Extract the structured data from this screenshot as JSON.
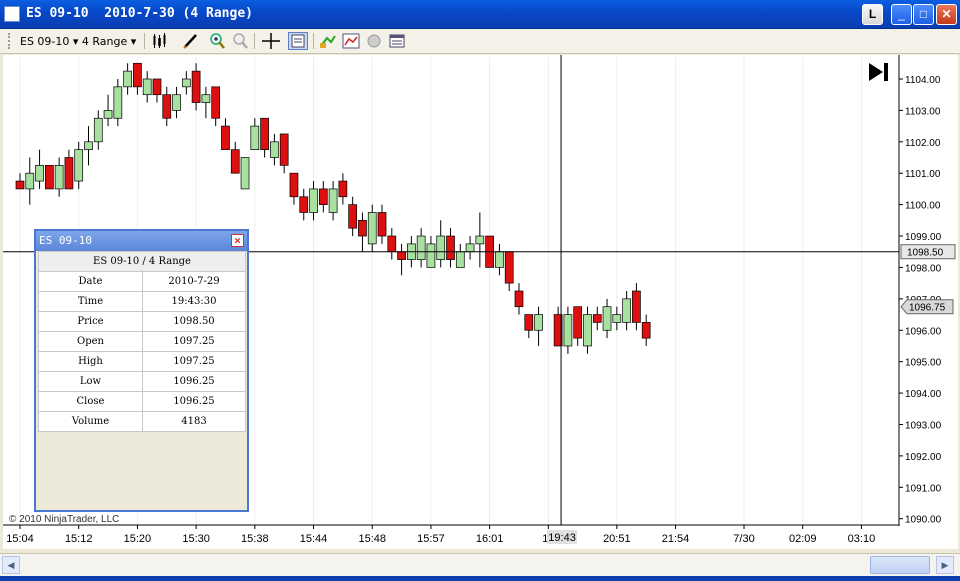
{
  "window": {
    "title": "ES 09-10  2010-7-30 (4 Range)",
    "buttons": {
      "l": "L",
      "minimize": "_",
      "maximize": "□",
      "close": "✕"
    }
  },
  "toolbar": {
    "instrument": "ES 09-10 ▾ 4 Range ▾",
    "icons": [
      "candlestick-icon",
      "pencil-icon",
      "zoom-in-icon",
      "zoom-out-icon",
      "crosshair-icon",
      "data-box-icon",
      "instrument-icon",
      "indicators-icon",
      "strategy-icon",
      "properties-icon"
    ]
  },
  "copyright": "© 2010 NinjaTrader, LLC",
  "colors": {
    "up": "#a8e0a0",
    "down": "#dd1010",
    "wick": "#000000",
    "crosshair": "#000000"
  },
  "chart_data": {
    "type": "candlestick",
    "ylim": [
      1089.8,
      1104.7
    ],
    "y_ticks": [
      "1104.00",
      "1103.00",
      "1102.00",
      "1101.00",
      "1100.00",
      "1099.00",
      "1098.00",
      "1097.00",
      "1096.00",
      "1095.00",
      "1094.00",
      "1093.00",
      "1092.00",
      "1091.00",
      "1090.00"
    ],
    "y_tick_values": [
      1104,
      1103,
      1102,
      1101,
      1100,
      1099,
      1098,
      1097,
      1096,
      1095,
      1094,
      1093,
      1092,
      1091,
      1090
    ],
    "x_ticks": [
      "15:04",
      "15:12",
      "15:20",
      "15:30",
      "15:38",
      "15:44",
      "15:48",
      "15:57",
      "16:01",
      "18",
      "20:51",
      "21:54",
      "7/30",
      "02:09",
      "03:10"
    ],
    "x_tick_bars": [
      0,
      6,
      12,
      18,
      24,
      30,
      36,
      42,
      48,
      54,
      61,
      67,
      74,
      80,
      86
    ],
    "crosshair": {
      "price": 1098.5,
      "price_label": "1098.50",
      "bar": 55.3,
      "time_label": "19:43"
    },
    "last_price": {
      "value": 1096.75,
      "label": "1096.75"
    },
    "candles": [
      [
        1100.75,
        1100.5,
        1101.0,
        1100.5
      ],
      [
        1100.5,
        1101.0,
        1101.5,
        1100.0
      ],
      [
        1100.75,
        1101.25,
        1101.75,
        1100.5
      ],
      [
        1101.25,
        1100.5,
        1101.25,
        1100.5
      ],
      [
        1100.5,
        1101.25,
        1101.5,
        1100.25
      ],
      [
        1101.5,
        1100.5,
        1101.75,
        1100.5
      ],
      [
        1100.75,
        1101.75,
        1102.0,
        1100.5
      ],
      [
        1101.75,
        1102.0,
        1102.5,
        1101.25
      ],
      [
        1102.0,
        1102.75,
        1103.0,
        1101.75
      ],
      [
        1102.75,
        1103.0,
        1103.5,
        1102.5
      ],
      [
        1102.75,
        1103.75,
        1104.0,
        1102.5
      ],
      [
        1103.75,
        1104.25,
        1104.5,
        1103.5
      ],
      [
        1104.5,
        1103.75,
        1104.5,
        1103.5
      ],
      [
        1103.5,
        1104.0,
        1104.25,
        1103.25
      ],
      [
        1104.0,
        1103.5,
        1104.0,
        1103.25
      ],
      [
        1103.5,
        1102.75,
        1103.75,
        1102.5
      ],
      [
        1103.0,
        1103.5,
        1103.75,
        1102.75
      ],
      [
        1103.75,
        1104.0,
        1104.25,
        1103.5
      ],
      [
        1104.25,
        1103.25,
        1104.5,
        1103.0
      ],
      [
        1103.25,
        1103.5,
        1103.75,
        1102.75
      ],
      [
        1103.75,
        1102.75,
        1103.75,
        1102.5
      ],
      [
        1102.5,
        1101.75,
        1102.75,
        1101.75
      ],
      [
        1101.75,
        1101.0,
        1102.0,
        1101.0
      ],
      [
        1100.5,
        1101.5,
        1101.5,
        1100.5
      ],
      [
        1101.75,
        1102.5,
        1102.75,
        1101.75
      ],
      [
        1102.75,
        1101.75,
        1102.75,
        1101.5
      ],
      [
        1101.5,
        1102.0,
        1102.25,
        1101.25
      ],
      [
        1102.25,
        1101.25,
        1102.25,
        1101.0
      ],
      [
        1101.0,
        1100.25,
        1101.0,
        1100.0
      ],
      [
        1100.25,
        1099.75,
        1100.5,
        1099.5
      ],
      [
        1099.75,
        1100.5,
        1100.75,
        1099.5
      ],
      [
        1100.5,
        1100.0,
        1100.75,
        1099.75
      ],
      [
        1099.75,
        1100.5,
        1100.75,
        1099.5
      ],
      [
        1100.75,
        1100.25,
        1101.0,
        1100.0
      ],
      [
        1100.0,
        1099.25,
        1100.25,
        1099.0
      ],
      [
        1099.5,
        1099.0,
        1099.75,
        1098.5
      ],
      [
        1098.75,
        1099.75,
        1100.0,
        1098.5
      ],
      [
        1099.75,
        1099.0,
        1100.0,
        1098.75
      ],
      [
        1099.0,
        1098.5,
        1099.25,
        1098.25
      ],
      [
        1098.5,
        1098.25,
        1098.75,
        1097.75
      ],
      [
        1098.25,
        1098.75,
        1099.0,
        1098.0
      ],
      [
        1098.25,
        1099.0,
        1099.25,
        1098.0
      ],
      [
        1098.0,
        1098.75,
        1099.0,
        1098.0
      ],
      [
        1098.25,
        1099.0,
        1099.5,
        1098.0
      ],
      [
        1099.0,
        1098.25,
        1099.25,
        1098.0
      ],
      [
        1098.0,
        1098.5,
        1098.75,
        1098.0
      ],
      [
        1098.5,
        1098.75,
        1099.0,
        1098.25
      ],
      [
        1098.75,
        1099.0,
        1099.75,
        1098.0
      ],
      [
        1099.0,
        1098.0,
        1099.0,
        1098.0
      ],
      [
        1098.0,
        1098.5,
        1098.75,
        1097.75
      ],
      [
        1098.5,
        1097.5,
        1098.5,
        1097.25
      ],
      [
        1097.25,
        1096.75,
        1097.5,
        1096.5
      ],
      [
        1096.5,
        1096.0,
        1096.5,
        1095.75
      ],
      [
        1096.0,
        1096.5,
        1096.75,
        1095.5
      ],
      [
        1096.5,
        1095.5,
        1096.75,
        1095.5
      ],
      [
        1095.5,
        1096.5,
        1096.75,
        1095.25
      ],
      [
        1096.75,
        1095.75,
        1096.75,
        1095.5
      ],
      [
        1095.5,
        1096.5,
        1096.75,
        1095.25
      ],
      [
        1096.5,
        1096.25,
        1096.75,
        1096.0
      ],
      [
        1096.0,
        1096.75,
        1097.0,
        1095.75
      ],
      [
        1096.25,
        1096.5,
        1096.75,
        1096.0
      ],
      [
        1096.25,
        1097.0,
        1097.25,
        1096.0
      ],
      [
        1097.25,
        1096.25,
        1097.5,
        1096.0
      ],
      [
        1096.25,
        1095.75,
        1096.5,
        1095.5
      ]
    ]
  },
  "data_window": {
    "title": "ES 09-10",
    "header": "ES 09-10 / 4 Range",
    "rows": [
      {
        "label": "Date",
        "value": "2010-7-29"
      },
      {
        "label": "Time",
        "value": "19:43:30"
      },
      {
        "label": "Price",
        "value": "1098.50"
      },
      {
        "label": "Open",
        "value": "1097.25"
      },
      {
        "label": "High",
        "value": "1097.25"
      },
      {
        "label": "Low",
        "value": "1096.25"
      },
      {
        "label": "Close",
        "value": "1096.25"
      },
      {
        "label": "Volume",
        "value": "4183"
      }
    ]
  }
}
